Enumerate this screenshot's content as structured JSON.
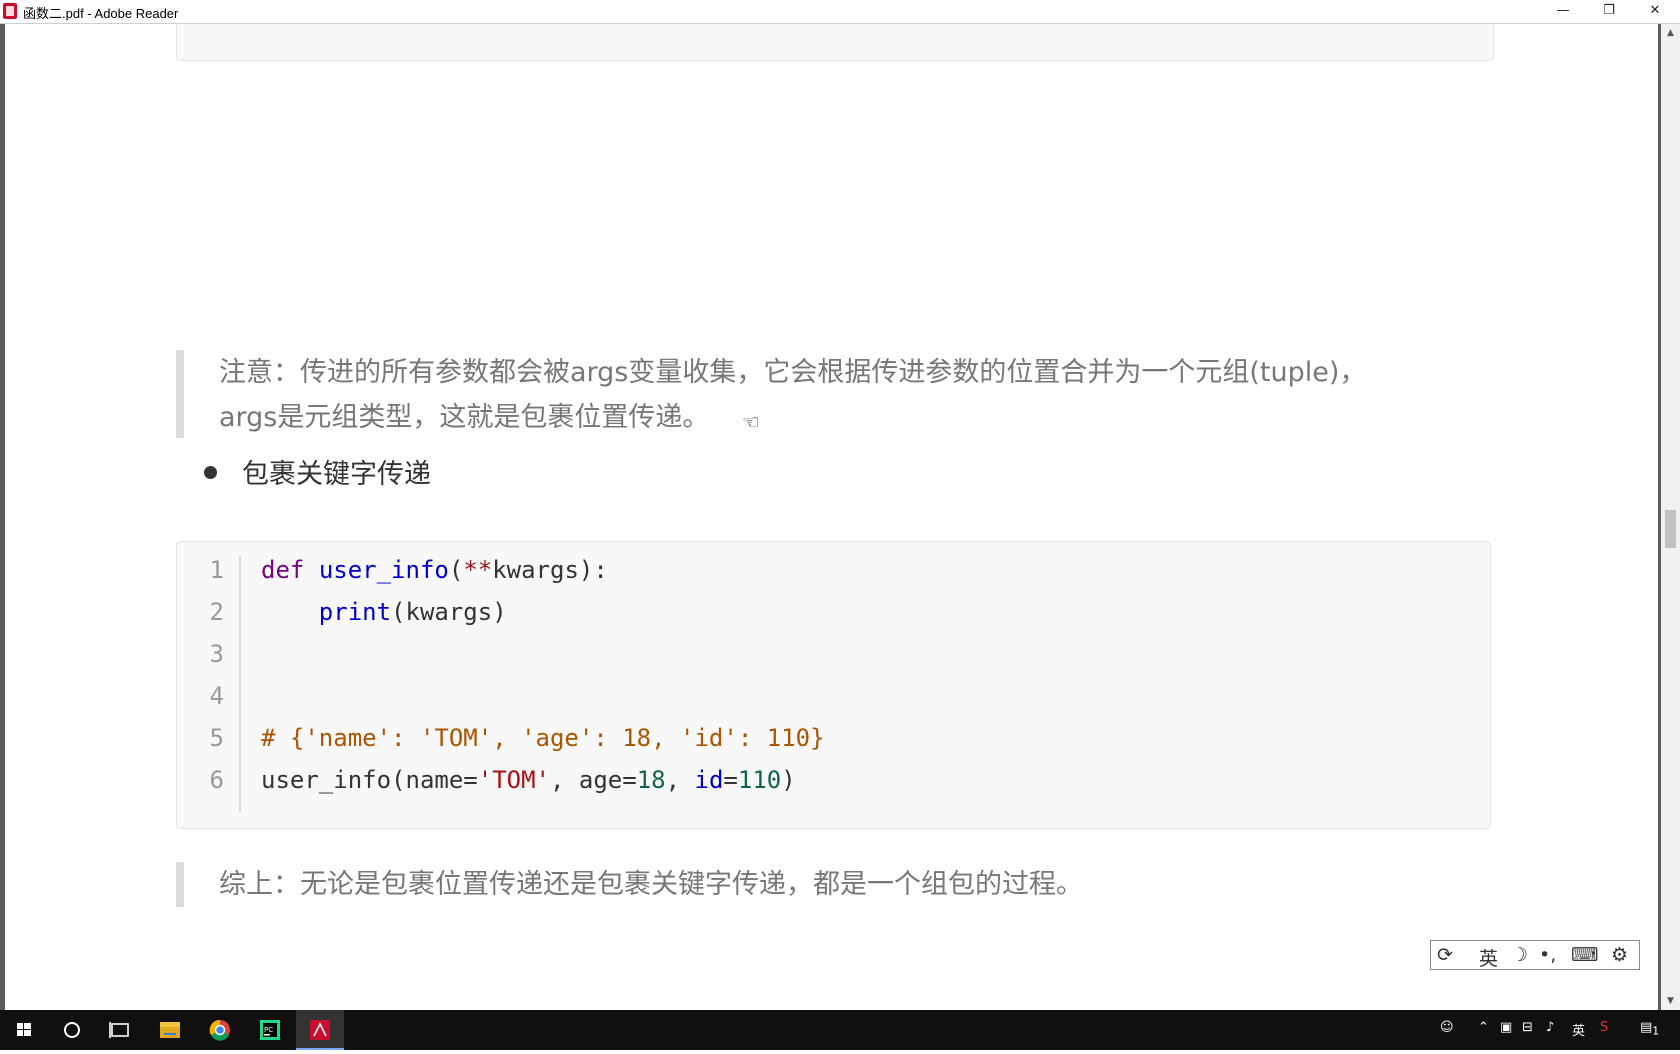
{
  "window": {
    "title": "函数二.pdf - Adobe Reader",
    "minimize": "—",
    "restore": "❐",
    "close": "✕"
  },
  "document": {
    "note1_line1": "注意：传进的所有参数都会被args变量收集，它会根据传进参数的位置合并为一个元组(tuple)，",
    "note1_line2": "args是元组类型，这就是包裹位置传递。",
    "bullet": "包裹关键字传递",
    "code": {
      "line_numbers": [
        "1",
        "2",
        "3",
        "4",
        "5",
        "6"
      ],
      "line1": {
        "kw": "def",
        "fn": "user_info",
        "paren_open": "(",
        "op": "**",
        "param": "kwargs",
        "tail": "):"
      },
      "line2": {
        "indent": "    ",
        "fn": "print",
        "args": "(kwargs)"
      },
      "line5": {
        "comment": "# {'name': 'TOM', 'age': 18, 'id': 110}"
      },
      "line6": {
        "fn": "user_info(name=",
        "s1": "'TOM'",
        "sep1": ", age=",
        "n1": "18",
        "sep2": ", ",
        "attr": "id",
        "eq": "=",
        "n2": "110",
        "close": ")"
      }
    },
    "note2": "综上：无论是包裹位置传递还是包裹关键字传递，都是一个组包的过程。"
  },
  "ime_toolbar": {
    "logo": "⟳",
    "lang": "英",
    "moon": "☽",
    "punct": "•,",
    "keyboard": "⌨",
    "settings": "⚙"
  },
  "taskbar": {
    "tray_lang": "英",
    "tray_notify_count": "1"
  },
  "colors": {
    "keyword": "#770088",
    "function": "#0000cc",
    "string": "#aa1111",
    "number": "#116644",
    "comment": "#aa5500"
  }
}
